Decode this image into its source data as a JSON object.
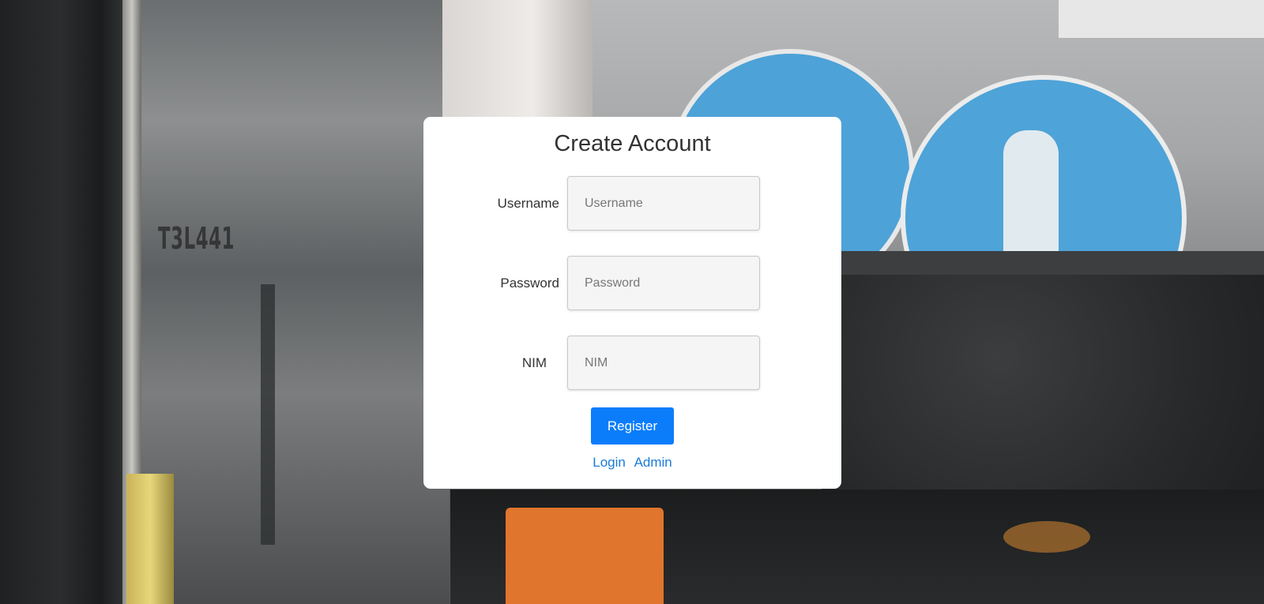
{
  "page": {
    "title": "Create Account"
  },
  "form": {
    "fields": [
      {
        "label": "Username",
        "placeholder": "Username",
        "value": ""
      },
      {
        "label": "Password",
        "placeholder": "Password",
        "value": ""
      },
      {
        "label": "NIM",
        "placeholder": "NIM",
        "value": ""
      }
    ],
    "register_label": "Register",
    "accent_color": "#0b7dfb"
  },
  "links": {
    "login": "Login",
    "admin": "Admin",
    "link_color": "#1a7bd8"
  },
  "background": {
    "sign_text": "T3L441"
  }
}
